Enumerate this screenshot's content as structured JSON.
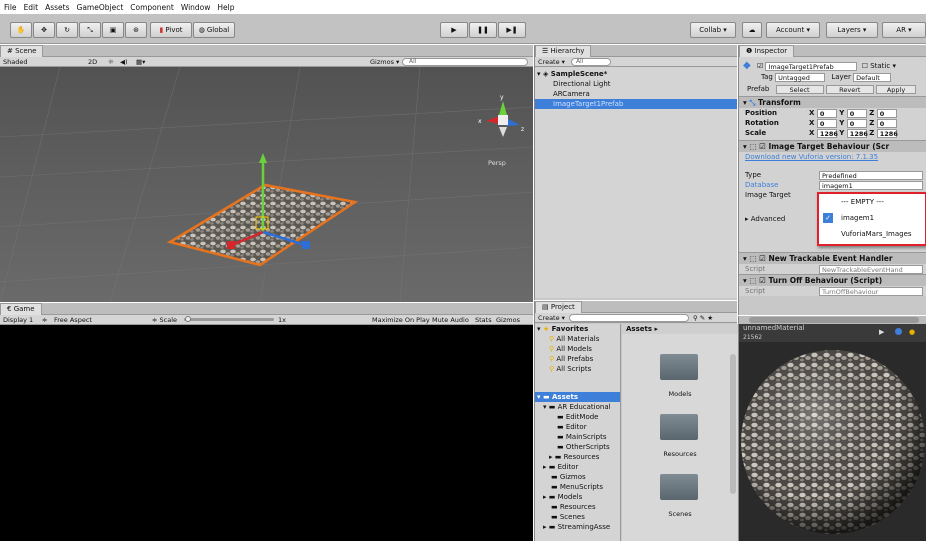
{
  "menu": [
    "File",
    "Edit",
    "Assets",
    "GameObject",
    "Component",
    "Window",
    "Help"
  ],
  "toolbar": {
    "pivot": "Pivot",
    "global": "Global",
    "collab": "Collab",
    "account": "Account",
    "layers": "Layers",
    "layout": "AR"
  },
  "scene": {
    "tab": "Scene",
    "shading": "Shaded",
    "mode2d": "2D",
    "gizmos": "Gizmos",
    "search": "All",
    "persp": "Persp"
  },
  "game": {
    "tab": "Game",
    "display": "Display 1",
    "aspect": "Free Aspect",
    "scale_label": "Scale",
    "scale_value": "1x",
    "options": [
      "Maximize On Play",
      "Mute Audio",
      "Stats",
      "Gizmos"
    ]
  },
  "hierarchy": {
    "tab": "Hierarchy",
    "create": "Create",
    "search": "All",
    "scene_name": "SampleScene*",
    "items": [
      "Directional Light",
      "ARCamera",
      "ImageTarget1Prefab"
    ]
  },
  "project": {
    "tab": "Project",
    "create": "Create",
    "favorites": "Favorites",
    "fav_items": [
      "All Materials",
      "All Models",
      "All Prefabs",
      "All Scripts"
    ],
    "assets_root": "Assets",
    "breadcrumb": "Assets",
    "tree": [
      "AR Educational",
      "EditMode",
      "Editor",
      "MainScripts",
      "OtherScripts",
      "Resources",
      "Editor",
      "Gizmos",
      "MenuScripts",
      "Models",
      "Resources",
      "Scenes",
      "StreamingAsse"
    ],
    "folders": [
      "Models",
      "Resources",
      "Scenes"
    ]
  },
  "inspector": {
    "tab": "Inspector",
    "object_name": "ImageTarget1Prefab",
    "static_label": "Static",
    "tag_label": "Tag",
    "tag_value": "Untagged",
    "layer_label": "Layer",
    "layer_value": "Default",
    "prefab_label": "Prefab",
    "select": "Select",
    "revert": "Revert",
    "apply": "Apply",
    "transform": "Transform",
    "position": "Position",
    "rotation": "Rotation",
    "scale": "Scale",
    "pos": [
      "0",
      "0",
      "0"
    ],
    "rot": [
      "0",
      "0",
      "0"
    ],
    "scl": [
      "1286",
      "1286",
      "1286"
    ],
    "itb_title": "Image Target Behaviour (Scr",
    "download_link": "Download new Vuforia version: 7.1.35",
    "type_label": "Type",
    "type_value": "Predefined",
    "database_label": "Database",
    "database_value": "imagem1",
    "image_target_label": "Image Target",
    "advanced": "Advanced",
    "dropdown_options": [
      "--- EMPTY ---",
      "imagem1",
      "VuforiaMars_Images"
    ],
    "trackable_title": "New Trackable Event Handler",
    "script_label": "Script",
    "trackable_script": "NewTrackableEventHand",
    "turnoff_title": "Turn Off Behaviour (Script)",
    "turnoff_script": "TurnOffBehaviour",
    "preview_title": "unnamedMaterial",
    "preview_sub": "21562"
  },
  "colors": {
    "accent": "#3d7fd9",
    "highlight_box": "#e0202a",
    "orange": "#e8731d"
  }
}
